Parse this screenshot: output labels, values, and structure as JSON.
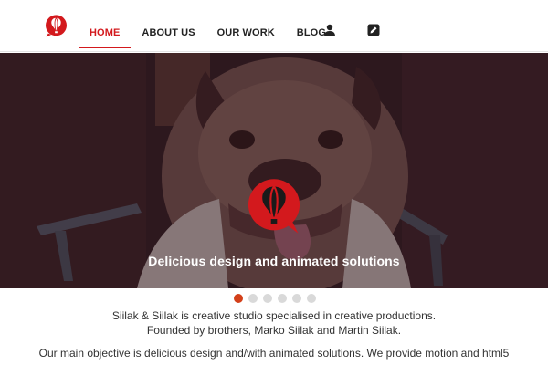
{
  "brand": {
    "accent": "#d3191d",
    "logo_icon": "hot-air-balloon-chat-icon"
  },
  "nav": {
    "items": [
      {
        "label": "HOME",
        "active": true
      },
      {
        "label": "ABOUT US",
        "active": false
      },
      {
        "label": "OUR WORK",
        "active": false
      },
      {
        "label": "BLOG",
        "active": false
      }
    ],
    "icons": [
      "user-icon",
      "pencil-icon"
    ]
  },
  "hero": {
    "tagline": "Delicious design and animated solutions",
    "image": "bulldog-photo"
  },
  "slider": {
    "slide_count": 6,
    "active_index": 0
  },
  "intro": {
    "line1": "Siilak & Siilak is creative studio specialised in creative productions.",
    "line2": "Founded by brothers, Marko Siilak and Martin Siilak.",
    "line3": "Our main objective is delicious design and/with animated solutions. We provide motion and html5"
  }
}
